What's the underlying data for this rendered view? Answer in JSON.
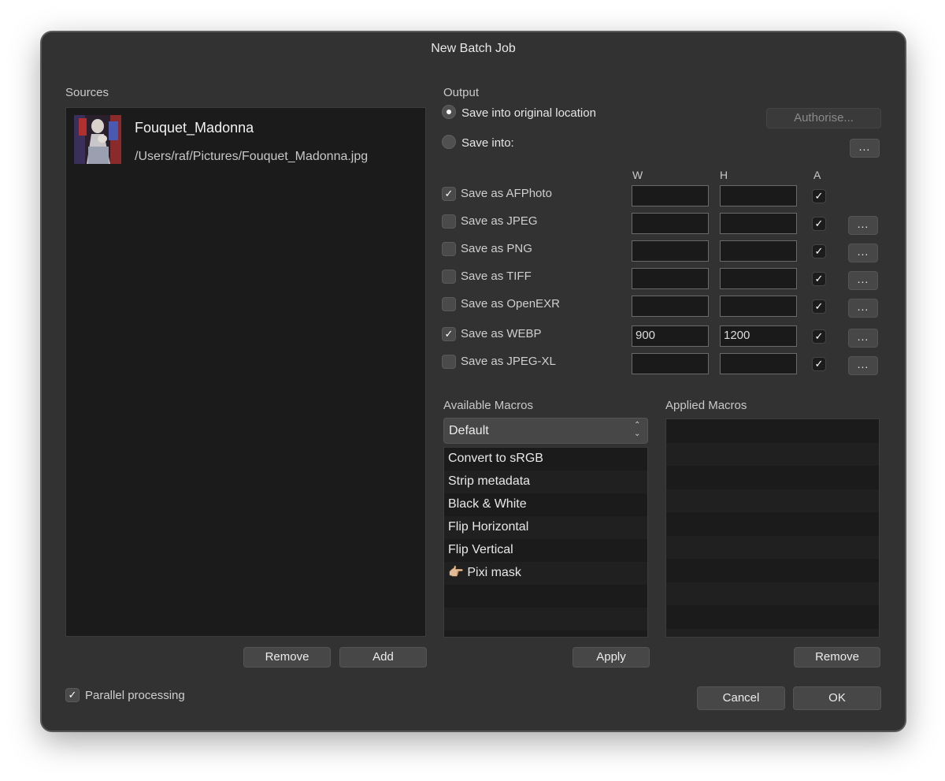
{
  "dialog": {
    "title": "New Batch Job"
  },
  "sources": {
    "label": "Sources",
    "items": [
      {
        "name": "Fouquet_Madonna",
        "path": "/Users/raf/Pictures/Fouquet_Madonna.jpg"
      }
    ],
    "remove_label": "Remove",
    "add_label": "Add"
  },
  "output": {
    "label": "Output",
    "save_original_label": "Save into original location",
    "save_into_label": "Save into:",
    "authorise_label": "Authorise...",
    "browse_label": "...",
    "columns": {
      "w": "W",
      "h": "H",
      "a": "A"
    },
    "formats": [
      {
        "label": "Save as AFPhoto",
        "checked": true,
        "w": "",
        "h": "",
        "a": true,
        "has_options": false
      },
      {
        "label": "Save as JPEG",
        "checked": false,
        "w": "",
        "h": "",
        "a": true,
        "has_options": true
      },
      {
        "label": "Save as PNG",
        "checked": false,
        "w": "",
        "h": "",
        "a": true,
        "has_options": true
      },
      {
        "label": "Save as TIFF",
        "checked": false,
        "w": "",
        "h": "",
        "a": true,
        "has_options": true
      },
      {
        "label": "Save as OpenEXR",
        "checked": false,
        "w": "",
        "h": "",
        "a": true,
        "has_options": true
      },
      {
        "label": "Save as WEBP",
        "checked": true,
        "w": "900",
        "h": "1200",
        "a": true,
        "has_options": true
      },
      {
        "label": "Save as JPEG-XL",
        "checked": false,
        "w": "",
        "h": "",
        "a": true,
        "has_options": true
      }
    ],
    "options_label": "..."
  },
  "macros": {
    "available_label": "Available Macros",
    "category": "Default",
    "items": [
      "Convert to sRGB",
      "Strip metadata",
      "Black & White",
      "Flip Horizontal",
      "Flip Vertical",
      "👉🏼 Pixi mask"
    ],
    "apply_label": "Apply",
    "applied_label": "Applied Macros",
    "applied_items": [],
    "remove_label": "Remove"
  },
  "footer": {
    "parallel_label": "Parallel processing",
    "parallel_checked": true,
    "cancel_label": "Cancel",
    "ok_label": "OK"
  }
}
